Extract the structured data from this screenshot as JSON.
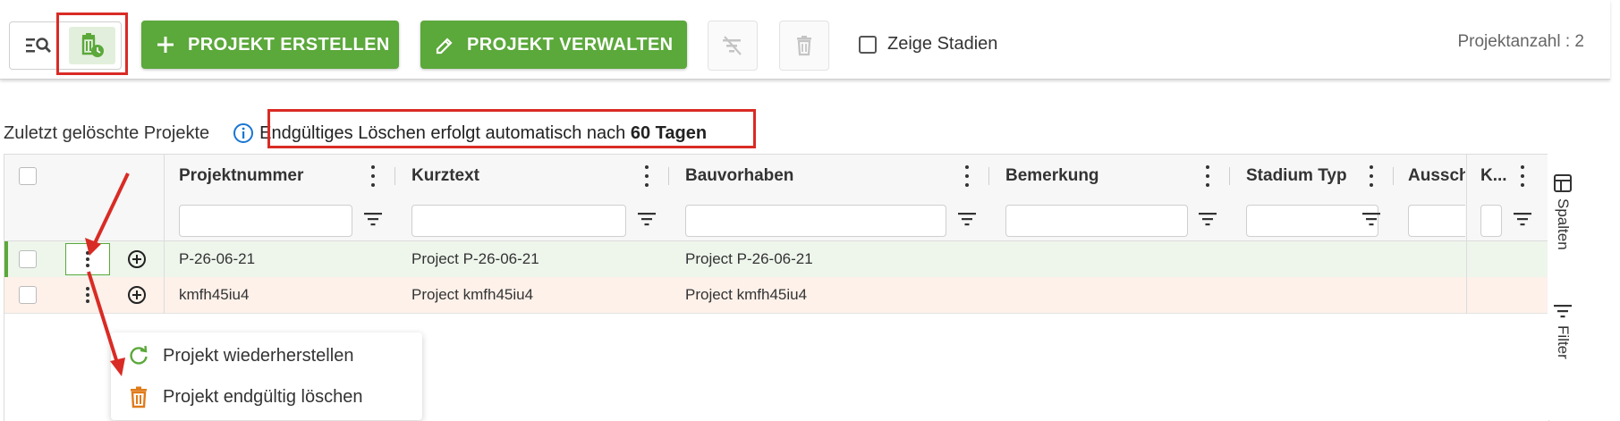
{
  "toolbar": {
    "create_label": "PROJEKT ERSTELLEN",
    "manage_label": "PROJEKT VERWALTEN",
    "show_stages_label": "Zeige Stadien",
    "project_count": "Projektanzahl : 2"
  },
  "info": {
    "title": "Zuletzt gelöschte Projekte",
    "text_prefix": "Endgültiges Löschen erfolgt automatisch nach ",
    "days": "60 Tagen"
  },
  "grid": {
    "columns": [
      "Projektnummer",
      "Kurztext",
      "Bauvorhaben",
      "Bemerkung",
      "Stadium Typ",
      "Aussch",
      "K..."
    ],
    "rows": [
      {
        "projektnummer": "P-26-06-21",
        "kurztext": "Project P-26-06-21",
        "bauvorhaben": "Project P-26-06-21"
      },
      {
        "projektnummer": "kmfh45iu4",
        "kurztext": "Project kmfh45iu4",
        "bauvorhaben": "Project kmfh45iu4"
      }
    ]
  },
  "sidebar": {
    "columns_label": "Spalten",
    "filter_label": "Filter"
  },
  "context_menu": {
    "restore_label": "Projekt wiederherstellen",
    "delete_label": "Projekt endgültig löschen"
  },
  "colors": {
    "accent_green": "#5ba83b",
    "highlight_red": "#d92b25",
    "delete_orange": "#e07b1a",
    "info_blue": "#1976d2"
  },
  "icons": [
    "search-list-icon",
    "deleted-projects-icon",
    "plus-icon",
    "pencil-icon",
    "filter-off-icon",
    "trash-icon",
    "info-icon",
    "column-menu-icon",
    "filter-icon",
    "more-vertical-icon",
    "add-circle-icon",
    "columns-icon",
    "restore-icon",
    "delete-forever-icon"
  ]
}
